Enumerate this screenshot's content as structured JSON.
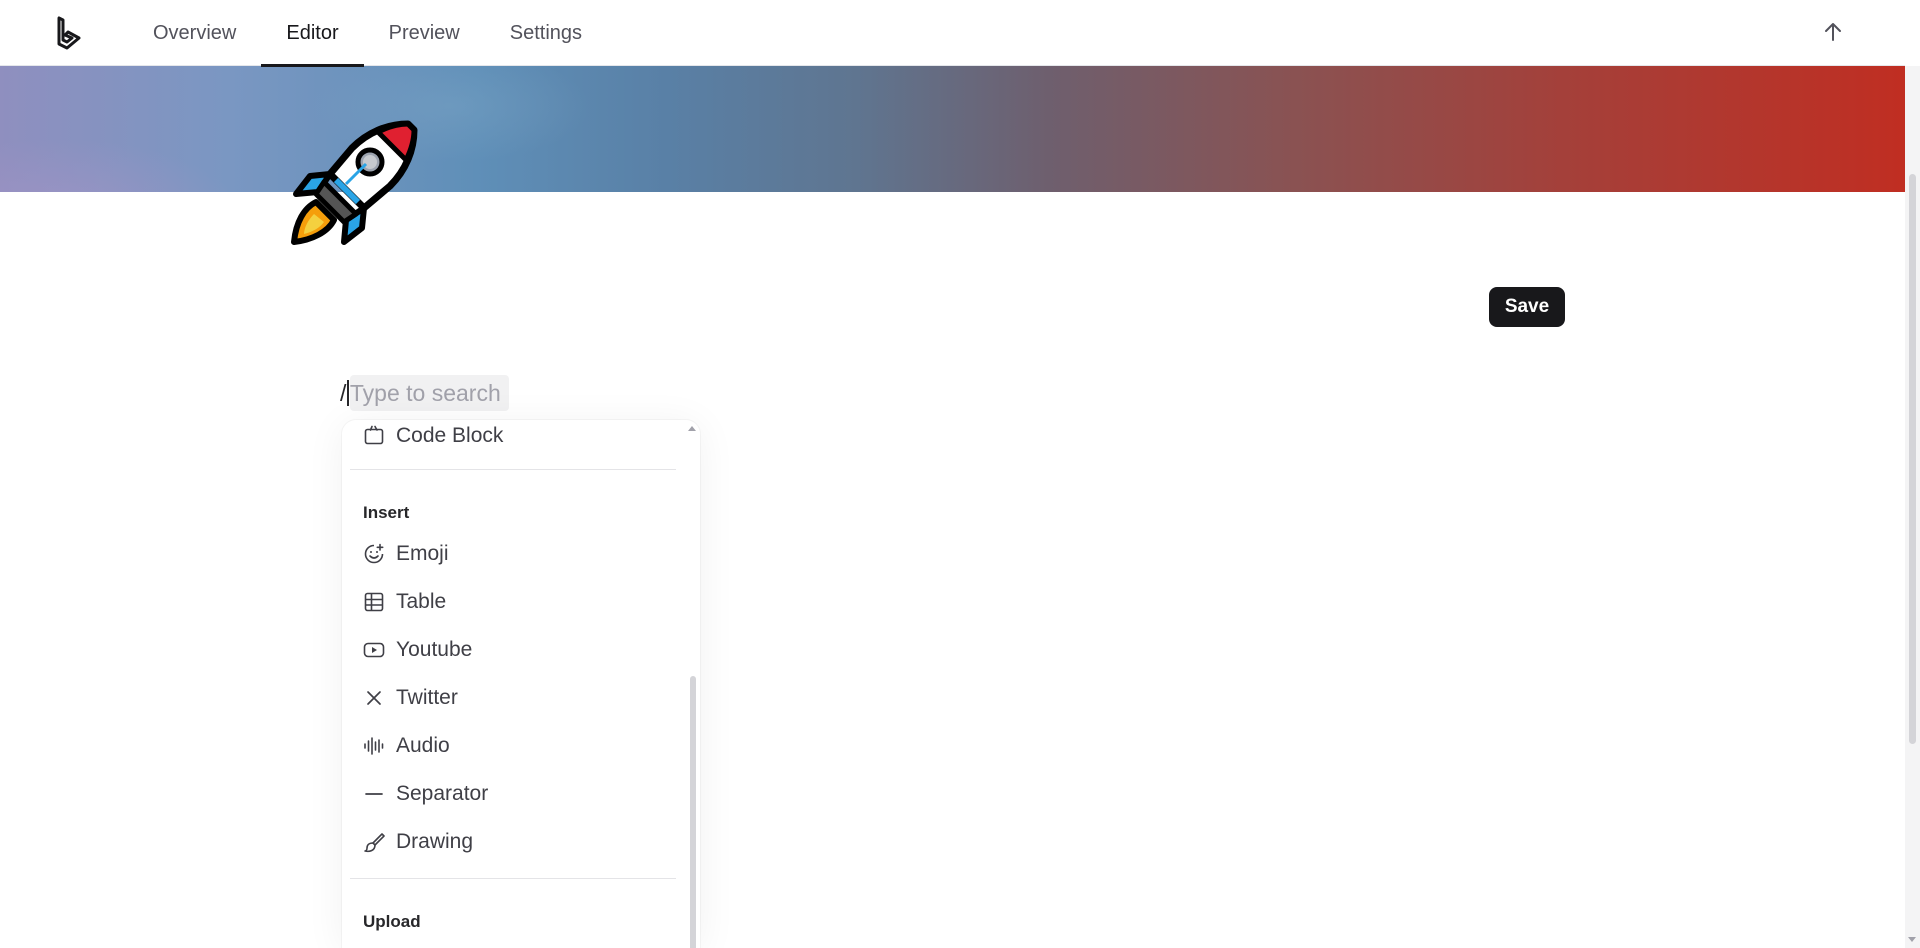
{
  "nav": {
    "tabs": [
      {
        "label": "Overview",
        "active": false
      },
      {
        "label": "Editor",
        "active": true
      },
      {
        "label": "Preview",
        "active": false
      },
      {
        "label": "Settings",
        "active": false
      }
    ],
    "scroll_top_icon": "arrow-up-icon",
    "logo_icon": "app-logo-icon"
  },
  "cover": {
    "gradient_colors": [
      "#8f8fbf",
      "#5f8fb8",
      "#6e5f6e",
      "#c02e22"
    ],
    "page_icon": "rocket-emoji"
  },
  "editor": {
    "save_label": "Save",
    "slash_char": "/",
    "search_placeholder": "Type to search"
  },
  "menu": {
    "top_item": {
      "label": "Code Block",
      "icon": "code-block-icon"
    },
    "sections": [
      {
        "title": "Insert",
        "items": [
          {
            "label": "Emoji",
            "icon": "emoji-icon"
          },
          {
            "label": "Table",
            "icon": "table-icon"
          },
          {
            "label": "Youtube",
            "icon": "youtube-icon"
          },
          {
            "label": "Twitter",
            "icon": "twitter-x-icon"
          },
          {
            "label": "Audio",
            "icon": "audio-icon"
          },
          {
            "label": "Separator",
            "icon": "separator-icon"
          },
          {
            "label": "Drawing",
            "icon": "drawing-brush-icon"
          }
        ]
      },
      {
        "title": "Upload",
        "items": []
      }
    ]
  }
}
